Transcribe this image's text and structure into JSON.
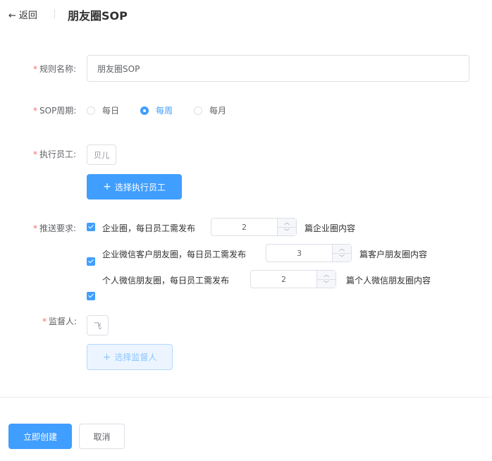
{
  "header": {
    "back_label": "返回",
    "title": "朋友圈SOP"
  },
  "form": {
    "name": {
      "label": "规则名称:",
      "value": "朋友圈SOP"
    },
    "period": {
      "label": "SOP周期:",
      "options": [
        "每日",
        "每周",
        "每月"
      ],
      "selected": "每周"
    },
    "staff": {
      "label": "执行员工:",
      "tag": "贝儿",
      "button": "选择执行员工"
    },
    "push": {
      "label": "推送要求:",
      "rows": [
        {
          "checked": true,
          "text": "企业圈，每日员工需发布",
          "value": "2",
          "suffix": "篇企业圈内容"
        },
        {
          "checked": true,
          "text": "企业微信客户朋友圈，每日员工需发布",
          "value": "3",
          "suffix": "篇客户朋友圈内容"
        },
        {
          "checked": true,
          "text": "个人微信朋友圈，每日员工需发布",
          "value": "2",
          "suffix": "篇个人微信朋友圈内容"
        }
      ]
    },
    "supervisor": {
      "label": "监督人:",
      "tag": "飞",
      "button": "选择监督人"
    }
  },
  "footer": {
    "submit": "立即创建",
    "cancel": "取消"
  },
  "colors": {
    "primary": "#409eff",
    "required_star": "#f56c6c",
    "border": "#dcdfe6"
  }
}
